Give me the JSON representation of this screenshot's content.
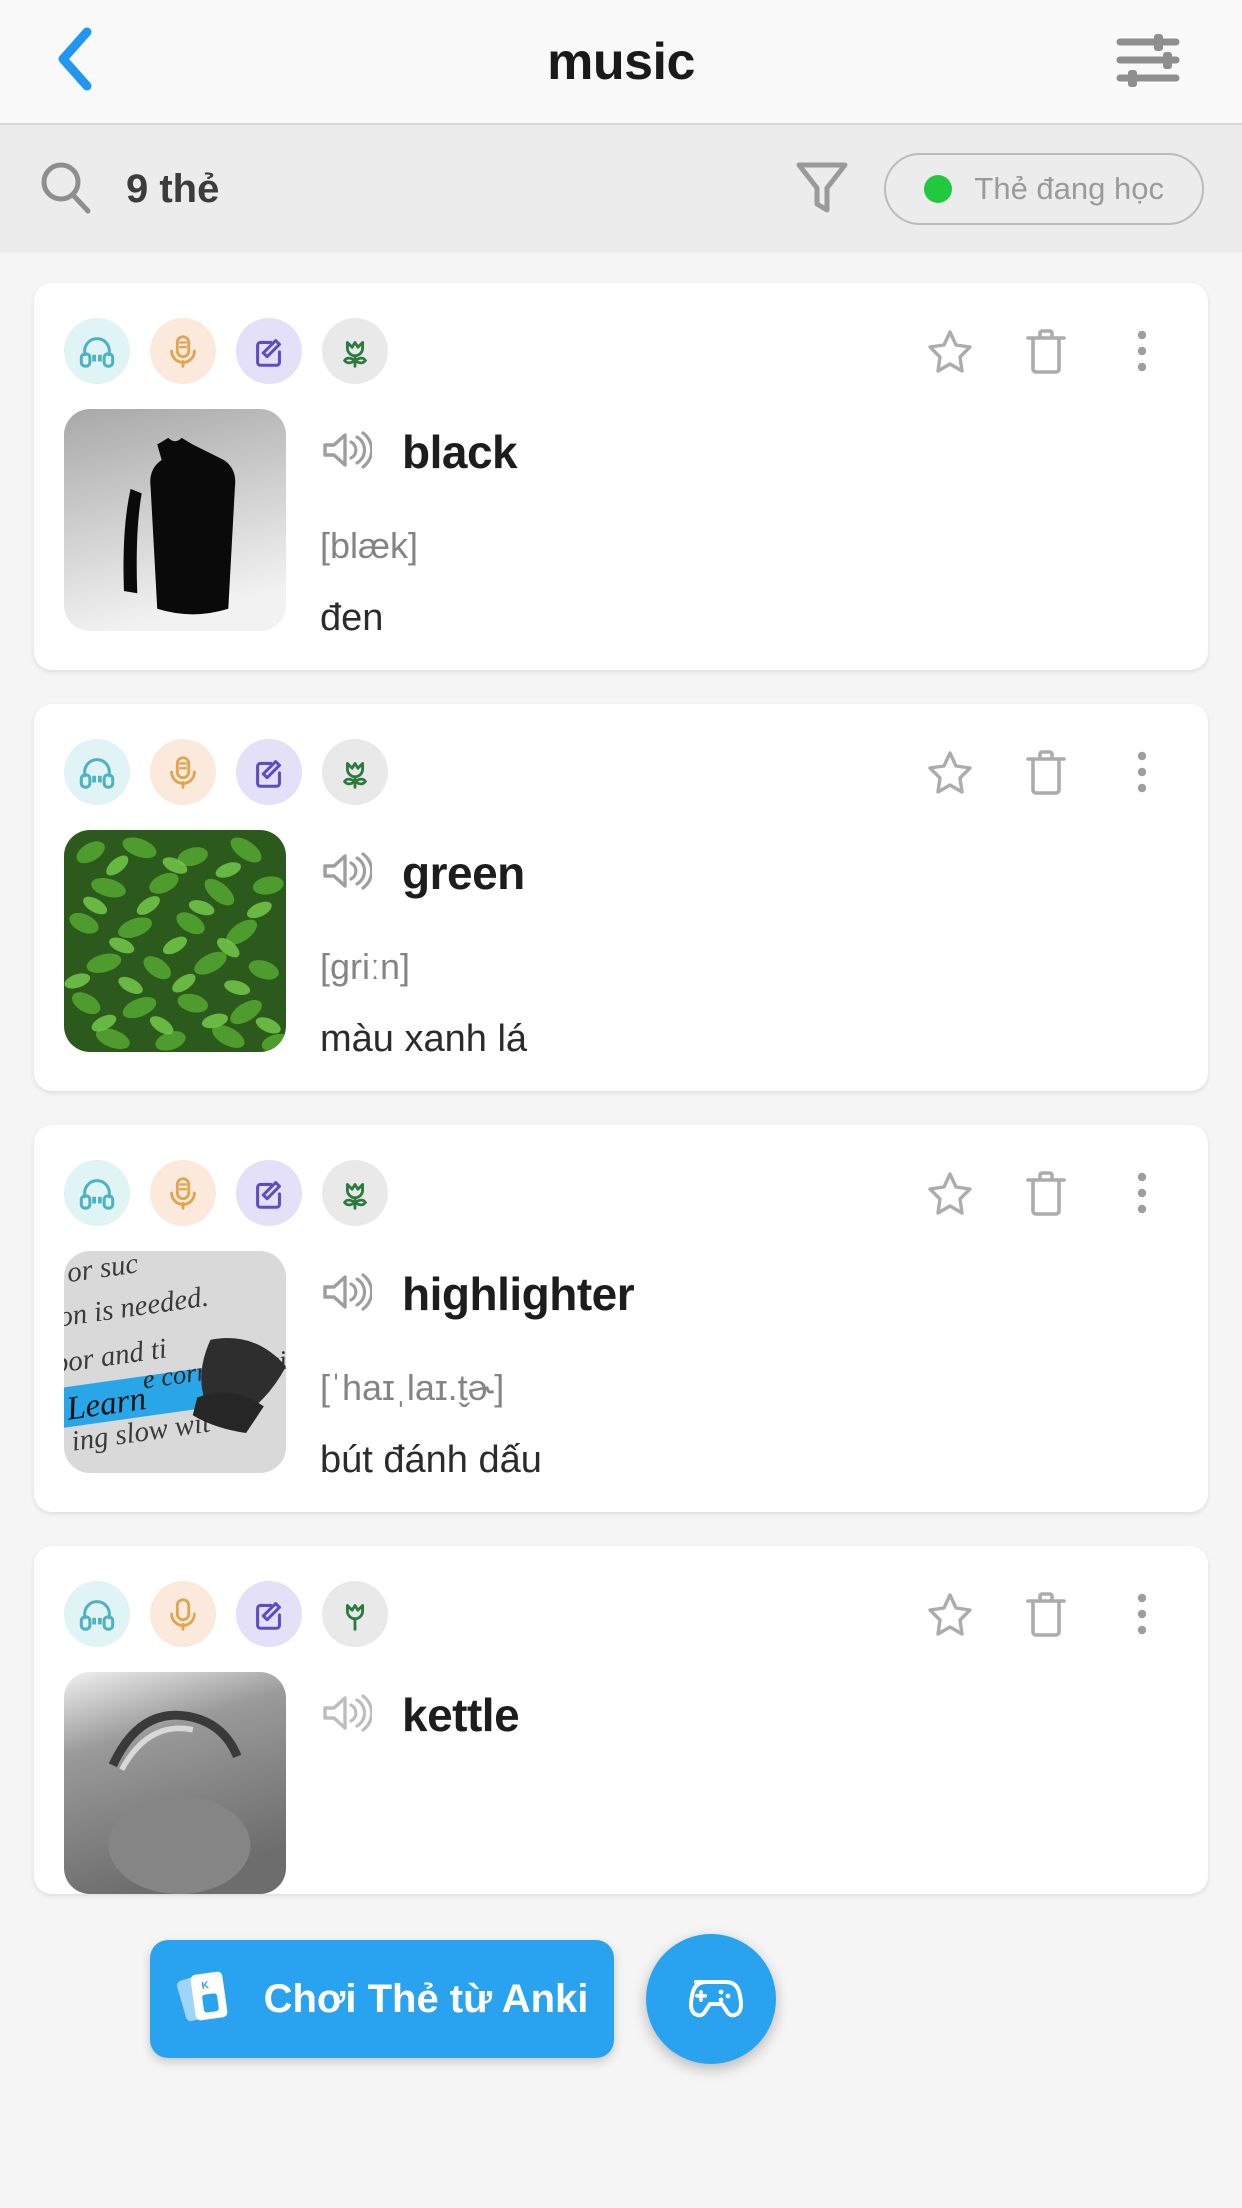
{
  "navbar": {
    "back_icon": "chevron-left-icon",
    "title": "music",
    "settings_icon": "sliders-icon",
    "back_color": "#2196f3"
  },
  "toolbar": {
    "search_icon": "search-icon",
    "card_count_label": "9 thẻ",
    "filter_icon": "funnel-icon",
    "status_pill": {
      "dot_color": "#22c93f",
      "label": "Thẻ đang học"
    }
  },
  "card_tools": {
    "listen_icon": "headphones-icon",
    "speak_icon": "microphone-icon",
    "write_icon": "edit-pencil-icon",
    "flower_icon": "tulip-icon",
    "star_icon": "star-outline-icon",
    "delete_icon": "trash-icon",
    "more_icon": "more-vertical-icon",
    "speaker_icon": "speaker-wave-icon",
    "colors": {
      "headphones": "#4fb3bf",
      "microphone": "#e0a552",
      "edit": "#5b4ec4",
      "flower": "#2d7a3e"
    }
  },
  "cards": [
    {
      "word": "black",
      "phonetic": "[blæk]",
      "translation": "đen",
      "image": "black-coat-photo"
    },
    {
      "word": "green",
      "phonetic": "[griːn]",
      "translation": "màu xanh lá",
      "image": "green-leaves-photo"
    },
    {
      "word": "highlighter",
      "phonetic": "[ˈhaɪˌlaɪ.t̬ɚ]",
      "translation": "bút đánh dấu",
      "image": "highlighted-book-page-photo"
    },
    {
      "word": "kettle",
      "phonetic": "",
      "translation": "",
      "image": "kettle-photo"
    }
  ],
  "floating": {
    "anki_button": {
      "label": "Chơi Thẻ từ Anki",
      "icon": "flashcards-icon",
      "color": "#29a3ef"
    },
    "game_button": {
      "icon": "gamepad-icon",
      "color": "#29a3ef"
    }
  }
}
